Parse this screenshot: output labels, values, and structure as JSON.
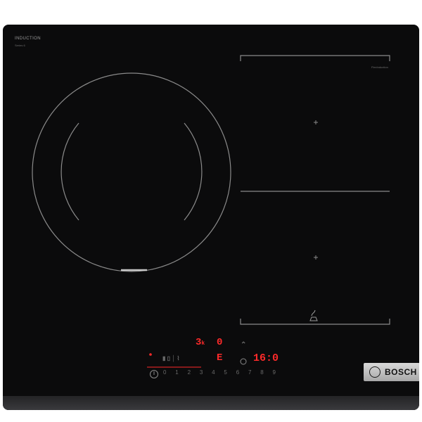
{
  "cooktop": {
    "brand_label": "INDUCTION",
    "brand_sublabel": "Series 6",
    "flex_zone_label": "FlexInduction",
    "logo": "BOSCH"
  },
  "control_panel": {
    "zone_level": "3",
    "zone_level_suffix": "k",
    "zone_level_right": "0",
    "timer_digit": "E",
    "timer_display": "16:0",
    "slider_marks": [
      "0",
      "1",
      "2",
      "3",
      "4",
      "5",
      "6",
      "7",
      "8",
      "9"
    ],
    "icons": [
      "power-icon",
      "lock-icon",
      "wifi-icon",
      "timer-icon",
      "pan-icon"
    ]
  },
  "colors": {
    "glass": "#0b0b0c",
    "display_red": "#ff2a2a",
    "markings": "#8a8a8a"
  }
}
